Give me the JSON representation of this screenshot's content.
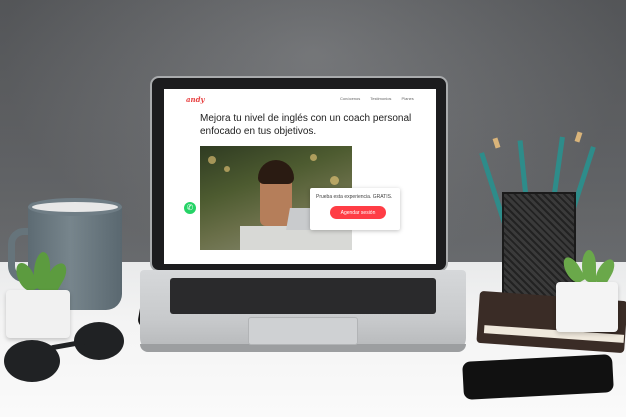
{
  "site": {
    "logo": "andy",
    "nav": [
      "Conócenos",
      "Testimonios",
      "Planes"
    ],
    "headline": "Mejora tu nivel de inglés con un coach personal enfocado en tus objetivos.",
    "cta_text": "Prueba esta experiencia. GRATIS.",
    "cta_button": "Agendar sesión",
    "brand_color": "#ff3d45",
    "whatsapp_color": "#25d366"
  },
  "scene_icons": [
    "whatsapp-icon"
  ]
}
